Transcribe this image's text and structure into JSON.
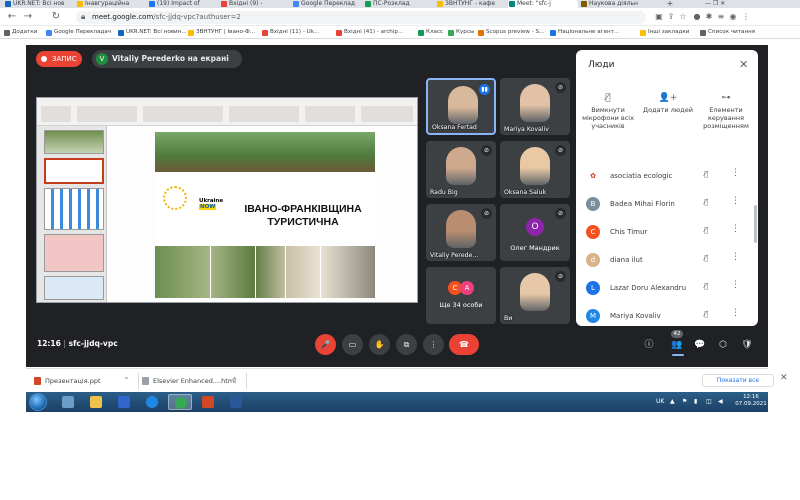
{
  "browser": {
    "tabs": [
      {
        "label": "UKR.NET: Всі нов",
        "fav_color": "#1565c0"
      },
      {
        "label": "Інавгураційна",
        "fav_color": "#fbbc04"
      },
      {
        "label": "(19) Impact of",
        "fav_color": "#1877f2"
      },
      {
        "label": "Вхідні (9) -",
        "fav_color": "#ea4335"
      },
      {
        "label": "Google Переклад",
        "fav_color": "#4285f4"
      },
      {
        "label": "ПС-Розклад",
        "fav_color": "#0f9d58"
      },
      {
        "label": "ЗВНТУНГ - кафе",
        "fav_color": "#fbbc04"
      },
      {
        "label": "Meet: \"sfc-j",
        "fav_color": "#00897b"
      },
      {
        "label": "Наукова діяльн",
        "fav_color": "#7b5e00"
      }
    ],
    "active_tab_index": 7,
    "new_tab": "+",
    "window_controls": "—   ❐   ✕",
    "nav": {
      "back": "←",
      "forward": "→",
      "reload": "↻"
    },
    "url_host": "meet.google.com",
    "url_path": "/sfc-jjdq-vpc?authuser=2",
    "bookmarks": [
      {
        "label": "Додатки",
        "color": "#5f6368"
      },
      {
        "label": "Google Перекладач",
        "color": "#4285f4"
      },
      {
        "label": "UKR.NET: Всі новин...",
        "color": "#1565c0"
      },
      {
        "label": "ЗВНТУНГ | Івано-Ф...",
        "color": "#fbbc04"
      },
      {
        "label": "Вхідні (11) - Uk...",
        "color": "#ea4335"
      },
      {
        "label": "Вхідні (41) - archip...",
        "color": "#ea4335"
      },
      {
        "label": "Класс",
        "color": "#0f9d58"
      },
      {
        "label": "Курсы",
        "color": "#34a853"
      },
      {
        "label": "Scopus preview - S...",
        "color": "#e37400"
      },
      {
        "label": "Національне агент...",
        "color": "#1a73e8"
      },
      {
        "label": "Інші закладки",
        "color": "#fbbc04"
      },
      {
        "label": "Список читання",
        "color": "#5f6368"
      }
    ]
  },
  "meet": {
    "recording_label": "ЗАПИС",
    "presenter_initial": "V",
    "presenter_text": "Vitaliy Perederko на екрані",
    "slide": {
      "title": "ІВАНО-ФРАНКІВЩИНА ТУРИСТИЧНА",
      "ukraine_label": "Ukraine",
      "now_label": "NOW"
    },
    "tiles": [
      {
        "name": "Oksana Fertad",
        "speaking": true,
        "face": "#d9b99b"
      },
      {
        "name": "Mariya Kovaliv",
        "speaking": false,
        "face": "#e2c2a6"
      },
      {
        "name": "Radu Big",
        "speaking": false,
        "face": "#cfa98e"
      },
      {
        "name": "Oksana Saluk",
        "speaking": false,
        "face": "#e9c9a3"
      },
      {
        "name": "Vitaliy Perede...",
        "speaking": false,
        "face": "#b98d70"
      },
      {
        "name": "Олег Мандрик",
        "speaking": false,
        "avatar": "О",
        "avatar_color": "#8e24aa"
      },
      {
        "name": "Ще 34 особи",
        "speaking": false,
        "mini": [
          "C",
          "A"
        ]
      },
      {
        "name": "Ви",
        "speaking": false,
        "face": "#e6c8a8"
      }
    ],
    "people_panel": {
      "title": "Люди",
      "close_icon": "✕",
      "actions": [
        {
          "icon": "🎙̸",
          "label": "Вимкнути мікрофони всіх учасників"
        },
        {
          "icon": "👤+",
          "label": "Додати людей"
        },
        {
          "icon": "⊶",
          "label": "Елементи керування розміщенням"
        }
      ],
      "participants": [
        {
          "name": "asociatia ecologic",
          "initial": "✿",
          "color": "#ffffff",
          "text_color": "#d93025"
        },
        {
          "name": "Badea Mihai Florin",
          "initial": "B",
          "color": "#78909c",
          "text_color": "#ffffff"
        },
        {
          "name": "Chis Timur",
          "initial": "C",
          "color": "#f4511e",
          "text_color": "#ffffff"
        },
        {
          "name": "diana ilut",
          "initial": "d",
          "color": "#d7b48a",
          "text_color": "#ffffff"
        },
        {
          "name": "Lazar Doru Alexandru",
          "initial": "L",
          "color": "#1a73e8",
          "text_color": "#ffffff"
        },
        {
          "name": "Mariya Kovaliv",
          "initial": "M",
          "color": "#1e88e5",
          "text_color": "#ffffff"
        }
      ]
    },
    "controls": {
      "time": "12:16",
      "separator": "|",
      "meeting_code": "sfc-jjdq-vpc",
      "people_count": "42",
      "mic_icon": "🎤",
      "cam_icon": "▭",
      "hand_icon": "✋",
      "present_icon": "⧉",
      "more_icon": "⋮",
      "end_icon": "☎",
      "info_icon": "ⓘ",
      "people_icon": "👥",
      "chat_icon": "💬",
      "activities_icon": "⬡",
      "host_icon": "🛡"
    }
  },
  "downloads": {
    "items": [
      {
        "name": "Презентація.ppt",
        "color": "#d24726"
      },
      {
        "name": "Elsevier Enhanced....html",
        "color": "#9aa0a6"
      }
    ],
    "show_all": "Показати все",
    "close": "✕",
    "chevron": "^"
  },
  "taskbar": {
    "apps": [
      {
        "name": "app-calculator",
        "color": "#6d9ec9"
      },
      {
        "name": "app-explorer",
        "color": "#f0c14b"
      },
      {
        "name": "app-save",
        "color": "#3366cc"
      },
      {
        "name": "app-edge",
        "color": "#1e88e5"
      },
      {
        "name": "app-chrome",
        "color": "#34a853"
      },
      {
        "name": "app-powerpoint",
        "color": "#d24726"
      },
      {
        "name": "app-word",
        "color": "#2b579a"
      }
    ],
    "active_app_index": 4,
    "language": "UK",
    "time": "12:16",
    "date": "07.09.2021"
  }
}
